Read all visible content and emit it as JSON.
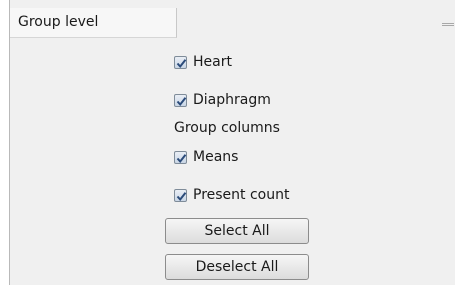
{
  "tab": {
    "label": "Group level"
  },
  "options": [
    {
      "label": "Heart",
      "checked": true
    },
    {
      "label": "Diaphragm",
      "checked": true
    }
  ],
  "group_columns": {
    "heading": "Group columns",
    "items": [
      {
        "label": "Means",
        "checked": true
      },
      {
        "label": "Present count",
        "checked": true
      }
    ]
  },
  "buttons": {
    "select_all": "Select All",
    "deselect_all": "Deselect All"
  },
  "icons": {
    "checkmark": "checkmark-icon",
    "minimize": "minimize-icon"
  },
  "colors": {
    "checkmark": "#2b4b7a",
    "panel_bg": "#f0f0f0"
  }
}
